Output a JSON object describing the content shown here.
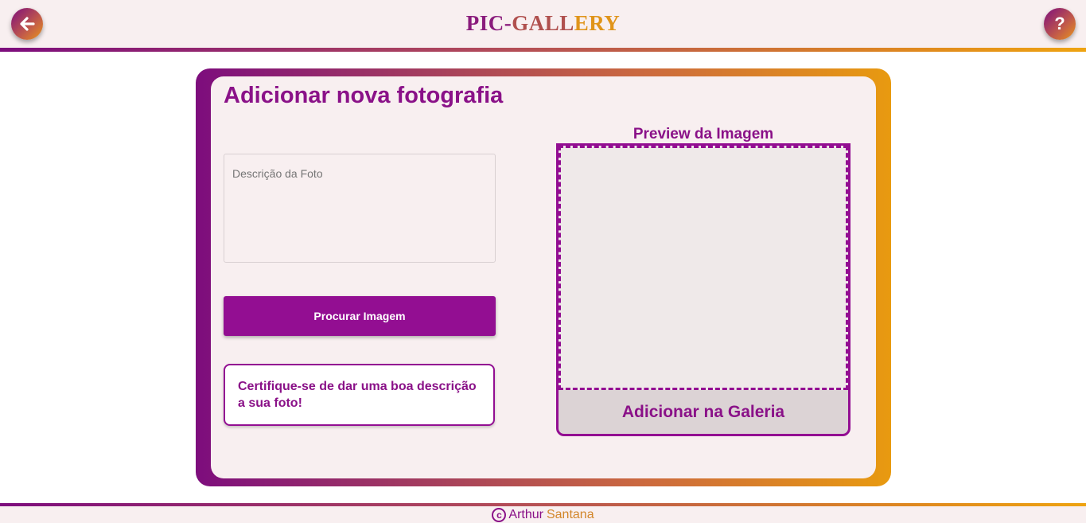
{
  "header": {
    "title_part1": "PIC-",
    "title_part2": "GALL",
    "title_part3": "ERY",
    "back_icon": "arrow-left-icon",
    "help_label": "?"
  },
  "form": {
    "heading": "Adicionar nova fotografia",
    "description_placeholder": "Descrição da Foto",
    "description_value": "",
    "browse_label": "Procurar Imagem",
    "tip": "Certifique-se de dar uma boa descrição a sua foto!"
  },
  "preview": {
    "label": "Preview da Imagem",
    "add_label": "Adicionar na Galeria"
  },
  "footer": {
    "copyright_symbol": "c",
    "name_first": "Arthur",
    "name_last": "Santana"
  },
  "colors": {
    "primary": "#930e92",
    "accent": "#e89a10",
    "panel_bg": "#f8eff0"
  }
}
